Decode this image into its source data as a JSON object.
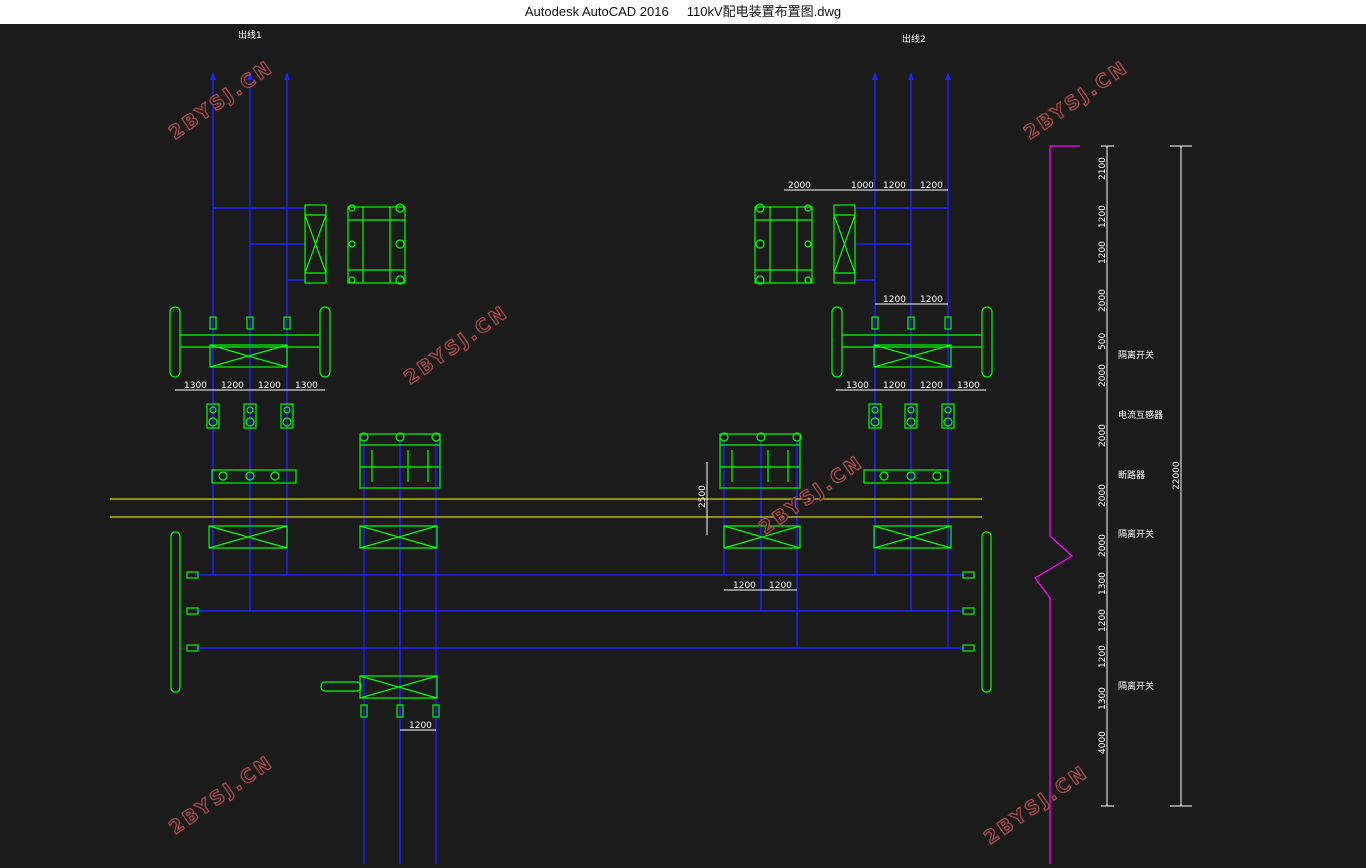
{
  "window": {
    "app_name": "Autodesk AutoCAD 2016",
    "file_name": "110kV配电装置布置图.dwg"
  },
  "colors": {
    "background": "#1b1b1b",
    "bus_line": "#2020ff",
    "equipment": "#00ff00",
    "guide_line": "#ffff00",
    "boundary": "#ff00ff",
    "dimension": "#ffffff",
    "watermark": "#b04a4a"
  },
  "drawing": {
    "outlet_labels": [
      "出线1",
      "出线2"
    ],
    "top_dims_right": [
      "2000",
      "1000",
      "1200",
      "1200"
    ],
    "mid_dims_right": [
      "1200",
      "1200"
    ],
    "left_row_dims": [
      "1300",
      "1200",
      "1200",
      "1300"
    ],
    "right_row_dims": [
      "1300",
      "1200",
      "1200",
      "1300"
    ],
    "bus_dims": [
      "1200",
      "1200"
    ],
    "bottom_dim": "1200",
    "height_dim": "2500",
    "vertical_dims": [
      "2100",
      "1200",
      "1200",
      "2000",
      "500",
      "2000",
      "2000",
      "2000",
      "2000",
      "1300",
      "1200",
      "1200",
      "1300",
      "4000"
    ],
    "total_dim": "22000",
    "equipment_labels": [
      "隔离开关",
      "电流互感器",
      "断路器",
      "隔离开关",
      "隔离开关"
    ],
    "watermark_text": "2BYSJ.CN"
  }
}
